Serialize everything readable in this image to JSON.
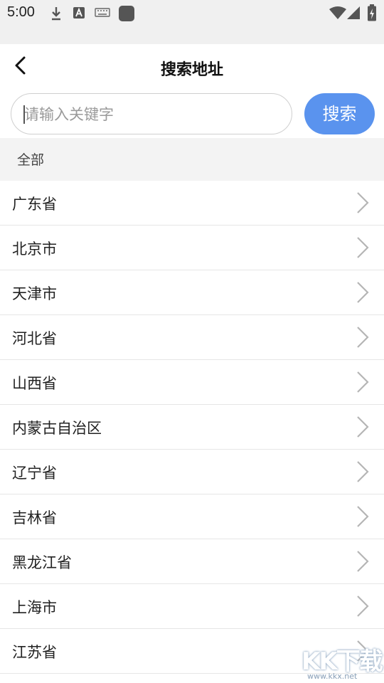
{
  "status_bar": {
    "time": "5:00",
    "icons": [
      "download-icon",
      "text-a-icon",
      "keyboard-icon",
      "app-square-icon",
      "wifi-icon",
      "signal-icon",
      "battery-icon"
    ]
  },
  "header": {
    "back_icon": "chevron-left-icon",
    "title": "搜索地址"
  },
  "search": {
    "placeholder": "请输入关键字",
    "value": "",
    "button_label": "搜索",
    "button_color": "#5a93ee"
  },
  "section": {
    "label": "全部"
  },
  "regions": [
    {
      "label": "广东省"
    },
    {
      "label": "北京市"
    },
    {
      "label": "天津市"
    },
    {
      "label": "河北省"
    },
    {
      "label": "山西省"
    },
    {
      "label": "内蒙古自治区"
    },
    {
      "label": "辽宁省"
    },
    {
      "label": "吉林省"
    },
    {
      "label": "黑龙江省"
    },
    {
      "label": "上海市"
    },
    {
      "label": "江苏省"
    }
  ],
  "watermark": {
    "text": "KK下载",
    "url": "www.kkx.net"
  }
}
